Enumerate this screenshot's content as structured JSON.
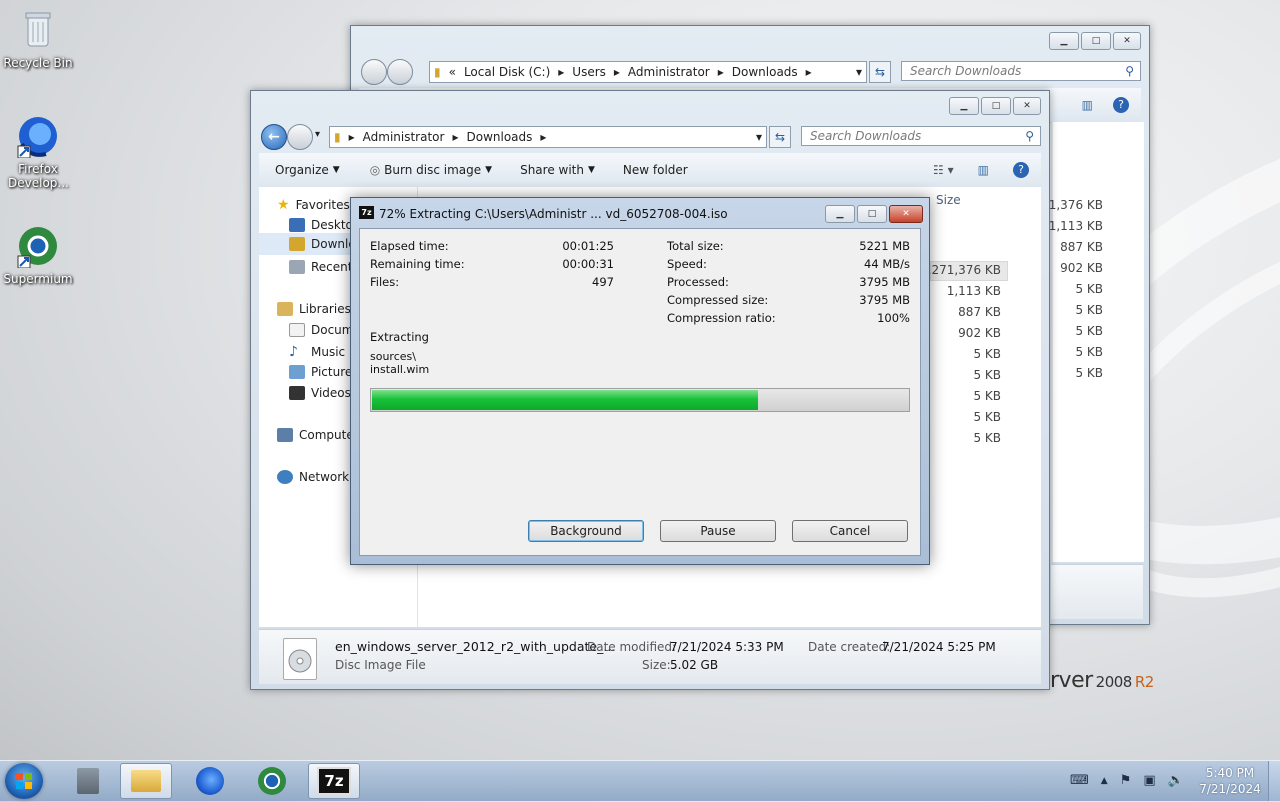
{
  "desktop": {
    "icons": [
      {
        "label": "Recycle Bin",
        "icon": "recycle-bin-icon"
      },
      {
        "label": "Firefox Develop...",
        "icon": "firefox-icon"
      },
      {
        "label": "Supermium",
        "icon": "supermium-icon"
      }
    ],
    "branding_text": "rver",
    "branding_version": "2008",
    "branding_r2": "R2"
  },
  "back_window": {
    "address": [
      "«",
      "Local Disk (C:)",
      "Users",
      "Administrator",
      "Downloads"
    ],
    "search_placeholder": "Search Downloads",
    "sizes": [
      "5,271,376 KB",
      "1,113 KB",
      "887 KB",
      "902 KB",
      "5 KB",
      "5 KB",
      "5 KB",
      "5 KB",
      "5 KB"
    ]
  },
  "front_window": {
    "address": [
      "Administrator",
      "Downloads"
    ],
    "search_placeholder": "Search Downloads",
    "toolbar": {
      "organize": "Organize",
      "burn": "Burn disc image",
      "share": "Share with",
      "new_folder": "New folder"
    },
    "nav": {
      "favorites": "Favorites",
      "desktop": "Desktop",
      "downloads": "Downlo",
      "recent": "Recent",
      "libraries": "Libraries",
      "documents": "Docum",
      "music": "Music",
      "pictures": "Pictures",
      "videos": "Videos",
      "computer": "Compute",
      "network": "Network"
    },
    "size_header": "Size",
    "sizes": [
      "5,271,376 KB",
      "1,113 KB",
      "887 KB",
      "902 KB",
      "5 KB",
      "5 KB",
      "5 KB",
      "5 KB",
      "5 KB"
    ],
    "details": {
      "filename": "en_windows_server_2012_r2_with_update_...",
      "type": "Disc Image File",
      "date_modified_label": "Date modified:",
      "date_modified": "7/21/2024 5:33 PM",
      "date_created_label": "Date created:",
      "date_created": "7/21/2024 5:25 PM",
      "size_label": "Size:",
      "size": "5.02 GB"
    }
  },
  "dialog": {
    "title": "72% Extracting C:\\Users\\Administr ... vd_6052708-004.iso",
    "progress_fraction": 0.72,
    "elapsed_label": "Elapsed time:",
    "elapsed": "00:01:25",
    "remaining_label": "Remaining time:",
    "remaining": "00:00:31",
    "files_label": "Files:",
    "files": "497",
    "total_label": "Total size:",
    "total": "5221 MB",
    "speed_label": "Speed:",
    "speed": "44 MB/s",
    "processed_label": "Processed:",
    "processed": "3795 MB",
    "compressed_label": "Compressed size:",
    "compressed": "3795 MB",
    "ratio_label": "Compression ratio:",
    "ratio": "100%",
    "extracting_label": "Extracting",
    "path_line1": "sources\\",
    "path_line2": "install.wim",
    "buttons": {
      "background": "Background",
      "pause": "Pause",
      "cancel": "Cancel"
    },
    "progress_color": "#19c23a"
  },
  "taskbar": {
    "time": "5:40 PM",
    "date": "7/21/2024",
    "sevenzip_label": "7z"
  }
}
